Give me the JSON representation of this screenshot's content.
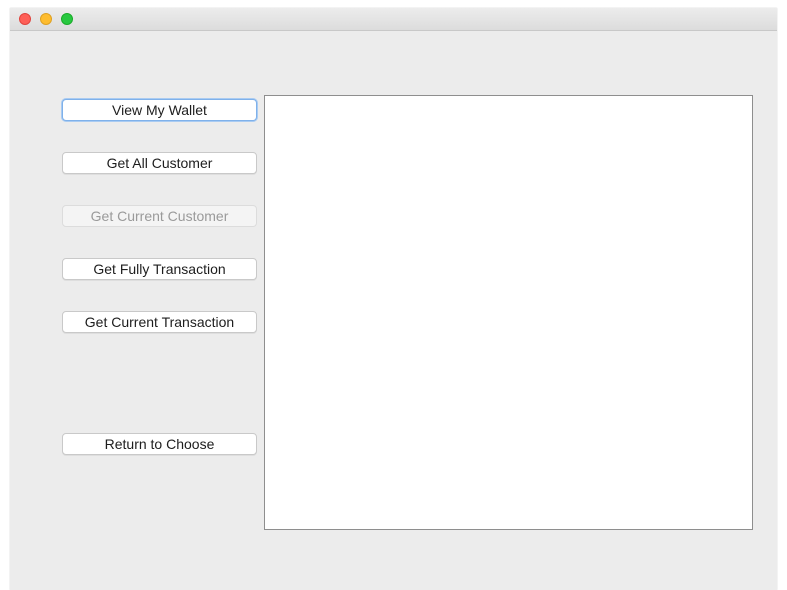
{
  "buttons": {
    "view_wallet": "View My Wallet",
    "get_all_customer": "Get All Customer",
    "get_current_customer": "Get Current Customer",
    "get_fully_transaction": "Get Fully Transaction",
    "get_current_transaction": "Get Current Transaction",
    "return_to_choose": "Return to Choose"
  },
  "content": {
    "text": ""
  }
}
